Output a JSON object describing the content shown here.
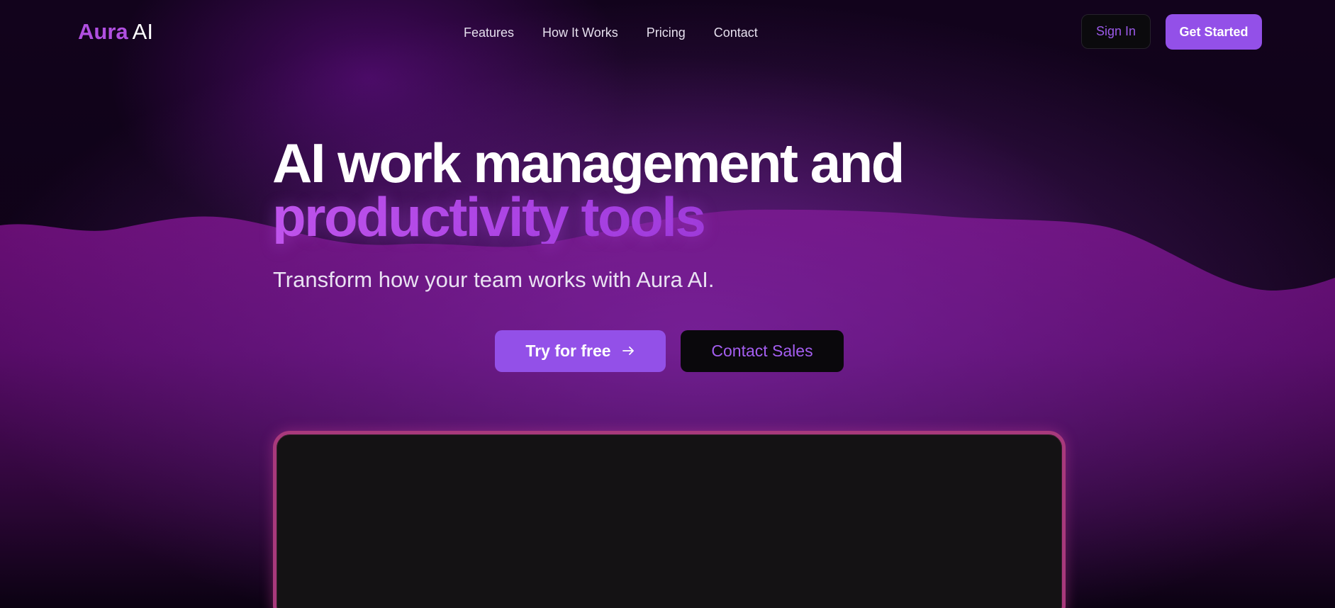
{
  "logo": {
    "brand": "Aura",
    "suffix": "AI"
  },
  "nav": {
    "links": [
      "Features",
      "How It Works",
      "Pricing",
      "Contact"
    ],
    "sign_in": "Sign In",
    "get_started": "Get Started"
  },
  "hero": {
    "title_line1": "AI work management and",
    "title_line2": "productivity tools",
    "subtitle": "Transform how your team works with Aura AI.",
    "primary_cta": "Try for free",
    "primary_cta_icon": "arrow-right-icon",
    "secondary_cta": "Contact Sales"
  },
  "colors": {
    "accent": "#9350e8",
    "brand_text": "#b04fe0",
    "background": "#0b0212",
    "wave": "#5e0e6e",
    "preview_border": "#a8397c"
  }
}
